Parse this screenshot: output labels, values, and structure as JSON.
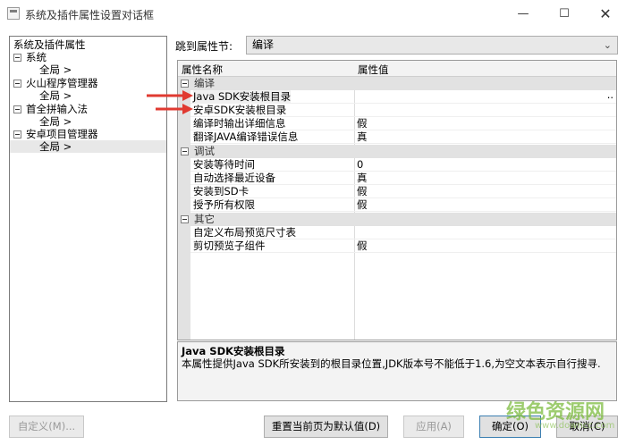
{
  "window": {
    "title": "系统及插件属性设置对话框",
    "minimize": "—",
    "maximize": "☐",
    "close": "✕"
  },
  "tree": {
    "items": [
      {
        "label": "系统及插件属性"
      },
      {
        "label": "系统"
      },
      {
        "label": "全局 >"
      },
      {
        "label": "火山程序管理器"
      },
      {
        "label": "全局 >"
      },
      {
        "label": "首全拼输入法"
      },
      {
        "label": "全局 >"
      },
      {
        "label": "安卓项目管理器"
      },
      {
        "label": "全局 >"
      }
    ]
  },
  "jump": {
    "label": "跳到属性节:",
    "value": "编译"
  },
  "grid": {
    "col_name": "属性名称",
    "col_value": "属性值",
    "ellipsis": "..",
    "rows": [
      {
        "name": "编译"
      },
      {
        "name": "Java SDK安装根目录",
        "value": ""
      },
      {
        "name": "安卓SDK安装根目录",
        "value": ""
      },
      {
        "name": "编译时输出详细信息",
        "value": "假"
      },
      {
        "name": "翻译JAVA编译错误信息",
        "value": "真"
      },
      {
        "name": "调试"
      },
      {
        "name": "安装等待时间",
        "value": "0"
      },
      {
        "name": "自动选择最近设备",
        "value": "真"
      },
      {
        "name": "安装到SD卡",
        "value": "假"
      },
      {
        "name": "授予所有权限",
        "value": "假"
      },
      {
        "name": "其它"
      },
      {
        "name": "自定义布局预览尺寸表",
        "value": ""
      },
      {
        "name": "剪切预览子组件",
        "value": "假"
      }
    ]
  },
  "description": {
    "title": "Java SDK安装根目录",
    "text": "本属性提供Java SDK所安装到的根目录位置,JDK版本号不能低于1.6,为空文本表示自行搜寻."
  },
  "buttons": {
    "customize": "自定义(M)...",
    "reset": "重置当前页为默认值(D)",
    "apply": "应用(A)",
    "ok": "确定(O)",
    "cancel": "取消(C)"
  },
  "watermark": {
    "text": "绿色资源网",
    "url": "www.downcc.com"
  },
  "colors": {
    "arrow": "#e03a31",
    "watermark": "#7dbb3f",
    "selection": "#e8e8e8"
  }
}
